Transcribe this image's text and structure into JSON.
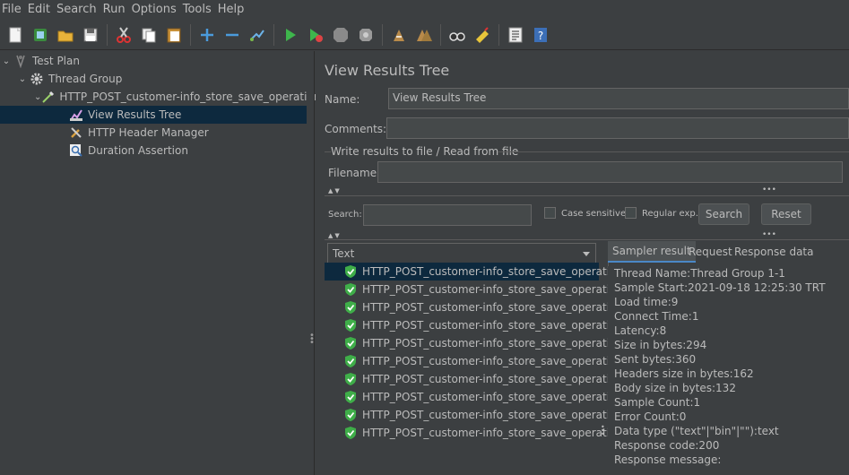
{
  "menu": [
    "File",
    "Edit",
    "Search",
    "Run",
    "Options",
    "Tools",
    "Help"
  ],
  "toolbar_icons": [
    "new-icon",
    "templates-icon",
    "open-icon",
    "save-icon",
    "cut-icon",
    "copy-icon",
    "paste-icon",
    "expand-icon",
    "collapse-icon",
    "toggle-icon",
    "start-icon",
    "start-no-pause-icon",
    "stop-icon",
    "shutdown-icon",
    "clear-icon",
    "clear-all-icon",
    "search-icon",
    "reset-search-icon",
    "function-helper-icon",
    "help-icon"
  ],
  "tree": {
    "test_plan": "Test Plan",
    "thread_group": "Thread Group",
    "sampler": "HTTP_POST_customer-info_store_save_operation",
    "view_results_tree": "View Results Tree",
    "header_manager": "HTTP Header Manager",
    "duration_assertion": "Duration Assertion"
  },
  "panel": {
    "title": "View Results Tree",
    "name_label": "Name:",
    "name_value": "View Results Tree",
    "comments_label": "Comments:",
    "comments_value": "",
    "file_group_label": "Write results to file / Read from file",
    "filename_label": "Filename",
    "filename_value": "",
    "search_label": "Search:",
    "search_value": "",
    "case_sensitive": "Case sensitive",
    "regular_exp": "Regular exp.",
    "search_button": "Search",
    "reset_button": "Reset",
    "renderer": "Text"
  },
  "results": [
    "HTTP_POST_customer-info_store_save_operation",
    "HTTP_POST_customer-info_store_save_operation",
    "HTTP_POST_customer-info_store_save_operation",
    "HTTP_POST_customer-info_store_save_operation",
    "HTTP_POST_customer-info_store_save_operation",
    "HTTP_POST_customer-info_store_save_operation",
    "HTTP_POST_customer-info_store_save_operation",
    "HTTP_POST_customer-info_store_save_operation",
    "HTTP_POST_customer-info_store_save_operation",
    "HTTP_POST_customer-info_store_save_operation"
  ],
  "tabs": [
    "Sampler result",
    "Request",
    "Response data"
  ],
  "sampler_result": [
    "Thread Name:Thread Group 1-1",
    "Sample Start:2021-09-18 12:25:30 TRT",
    "Load time:9",
    "Connect Time:1",
    "Latency:8",
    "Size in bytes:294",
    "Sent bytes:360",
    "Headers size in bytes:162",
    "Body size in bytes:132",
    "Sample Count:1",
    "Error Count:0",
    "Data type (\"text\"|\"bin\"|\"\"):text",
    "Response code:200",
    "Response message:"
  ],
  "colors": {
    "background": "#3c3f41",
    "selection": "#0d293e",
    "success_green": "#3fae49"
  }
}
